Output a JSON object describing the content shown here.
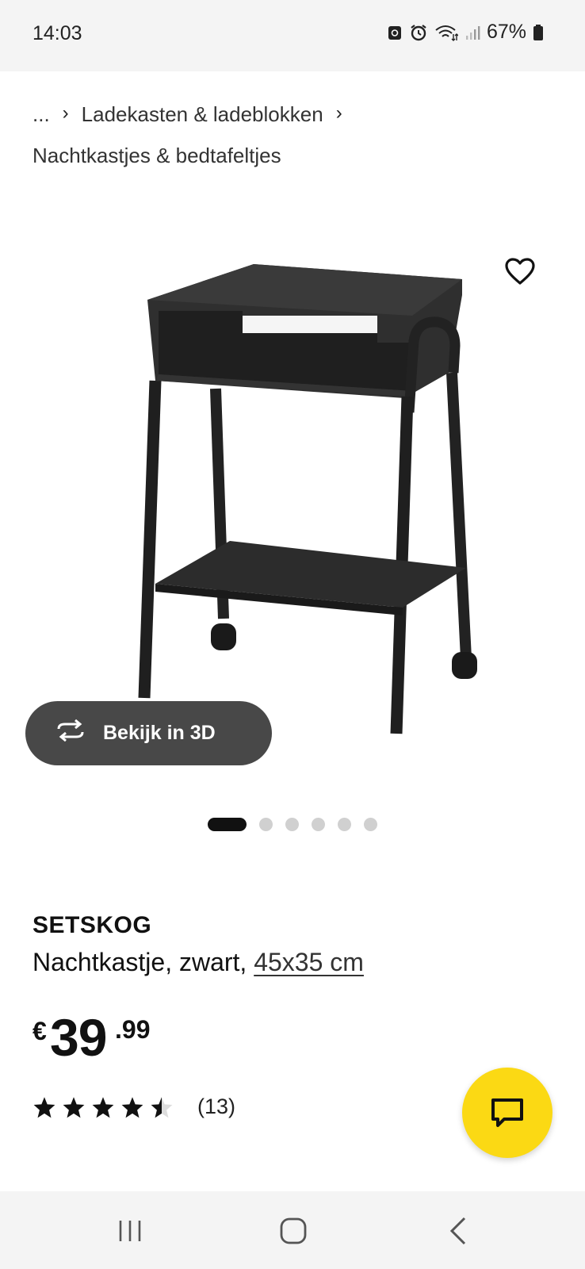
{
  "status_bar": {
    "time": "14:03",
    "battery": "67%",
    "icons": [
      "lock-icon",
      "alarm-icon",
      "wifi-icon",
      "signal-icon",
      "battery-icon"
    ]
  },
  "breadcrumb": {
    "ellipsis": "...",
    "items": [
      "Ladekasten & ladeblokken",
      "Nachtkastjes & bedtafeltjes"
    ]
  },
  "gallery": {
    "view_3d_label": "Bekijk in 3D",
    "image_count": 6,
    "active_index": 0
  },
  "product": {
    "name": "SETSKOG",
    "description": "Nachtkastje, zwart,",
    "size": "45x35 cm",
    "price_currency": "€",
    "price_integer": "39",
    "price_decimal": ".99",
    "rating": 4.5,
    "rating_max": 5,
    "review_count": "(13)"
  },
  "colors": {
    "accent_yellow": "#fbd914",
    "button_dark": "#484848",
    "text": "#111111"
  }
}
